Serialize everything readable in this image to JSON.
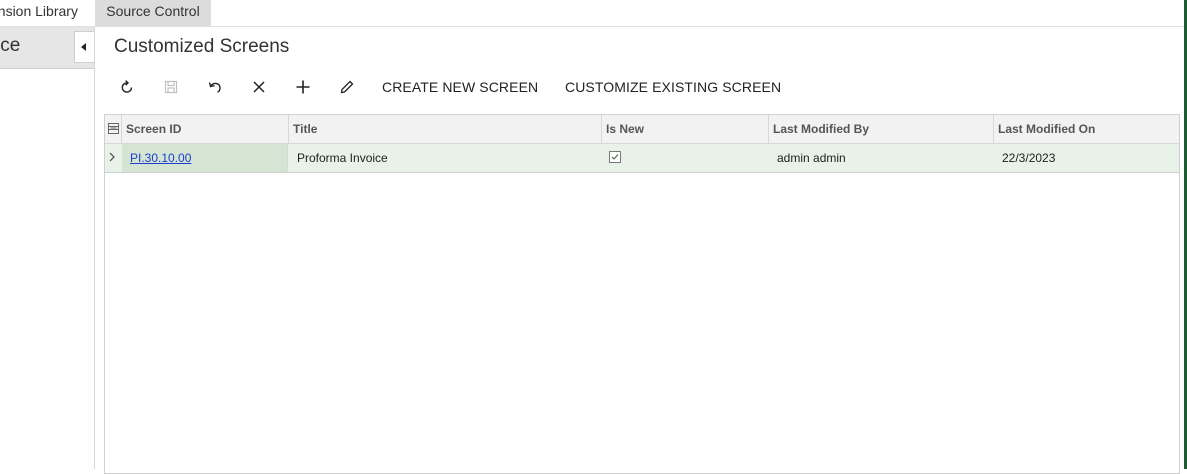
{
  "tabs": {
    "extension_library": "ension Library",
    "source_control": "Source Control"
  },
  "sidebar": {
    "title": "ice"
  },
  "page": {
    "title": "Customized Screens"
  },
  "toolbar": {
    "icons": [
      "refresh-icon",
      "save-icon",
      "undo-icon",
      "delete-icon",
      "add-icon",
      "edit-icon"
    ],
    "create_new_screen": "CREATE NEW SCREEN",
    "customize_existing_screen": "CUSTOMIZE EXISTING SCREEN"
  },
  "grid": {
    "columns": [
      "Screen ID",
      "Title",
      "Is New",
      "Last Modified By",
      "Last Modified On"
    ],
    "rows": [
      {
        "screen_id": "PI.30.10.00",
        "title": "Proforma Invoice",
        "is_new": true,
        "last_modified_by": "admin admin",
        "last_modified_on": "22/3/2023"
      }
    ]
  },
  "colors": {
    "selected_row": "#e9f2e8",
    "selected_cell": "#d5e5d3",
    "link": "#1a3fcc",
    "edge_accent": "#1e5a32"
  }
}
